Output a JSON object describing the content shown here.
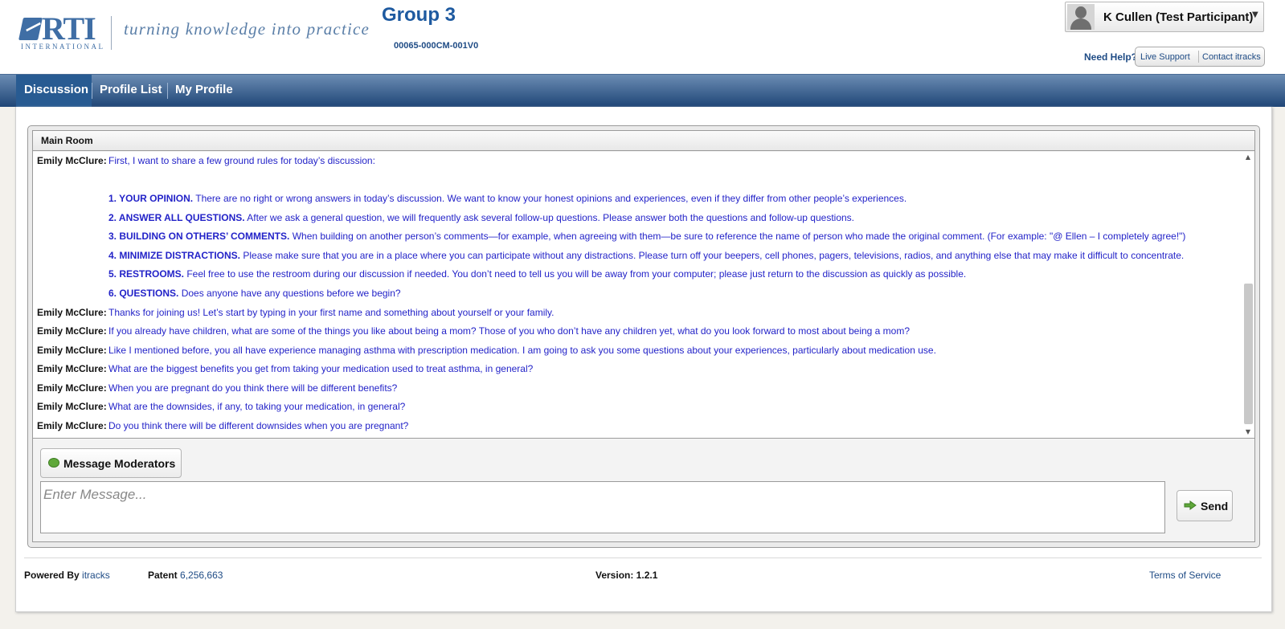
{
  "header": {
    "logo_text": "RTI",
    "logo_sub": "INTERNATIONAL",
    "tagline": "turning knowledge into practice",
    "group_title": "Group 3",
    "group_code": "00065-000CM-001V0",
    "user_name": "K Cullen (Test Participant)",
    "need_help": "Need Help?",
    "live_support": "Live Support",
    "contact": "Contact itracks"
  },
  "nav": {
    "items": [
      {
        "label": "Discussion",
        "active": true
      },
      {
        "label": "Profile List",
        "active": false
      },
      {
        "label": "My Profile",
        "active": false
      }
    ]
  },
  "chat": {
    "room_title": "Main Room",
    "messages": [
      {
        "sender": "Emily McClure:",
        "text": "First, I want to share a few ground rules for today’s discussion:"
      },
      {
        "sender": "",
        "bold": "1. YOUR OPINION.",
        "text": " There are no right or wrong answers in today’s discussion. We want to know your honest opinions and experiences, even if they differ from other people’s experiences."
      },
      {
        "sender": "",
        "bold": "2. ANSWER ALL QUESTIONS.",
        "text": " After we ask a general question, we will frequently ask several follow-up questions. Please answer both the questions and follow-up questions."
      },
      {
        "sender": "",
        "bold": "3. BUILDING ON OTHERS’ COMMENTS.",
        "text": " When building on another person’s comments—for example, when agreeing with them—be sure to reference the name of person who made the original comment. (For example: \"@ Ellen – I completely agree!\")"
      },
      {
        "sender": "",
        "bold": "4. MINIMIZE DISTRACTIONS.",
        "text": " Please make sure that you are in a place where you can participate without any distractions. Please turn off your beepers, cell phones, pagers, televisions, radios, and anything else that may make it difficult to concentrate."
      },
      {
        "sender": "",
        "bold": "5. RESTROOMS.",
        "text": " Feel free to use the restroom during our discussion if needed. You don’t need to tell us you will be away from your computer; please just return to the discussion as quickly as possible."
      },
      {
        "sender": "",
        "bold": "6. QUESTIONS.",
        "text": " Does anyone have any questions before we begin?"
      },
      {
        "sender": "Emily McClure:",
        "text": "Thanks for joining us! Let’s start by typing in your first name and something about yourself or your family."
      },
      {
        "sender": "Emily McClure:",
        "text": "If you already have children, what are some of the things you like about being a mom? Those of you who don’t have any children yet, what do you look forward to most about being a mom?"
      },
      {
        "sender": "Emily McClure:",
        "text": "Like I mentioned before, you all have experience managing asthma with prescription medication. I am going to ask you some questions about your experiences, particularly about medication use."
      },
      {
        "sender": "Emily McClure:",
        "text": "What are the biggest benefits you get from taking your medication used to treat asthma, in general?"
      },
      {
        "sender": "Emily McClure:",
        "text": "When you are pregnant do you think there will be different benefits?"
      },
      {
        "sender": "Emily McClure:",
        "text": "What are the downsides, if any, to taking your medication, in general?"
      },
      {
        "sender": "Emily McClure:",
        "text": "Do you think there will be different downsides when you are pregnant?"
      }
    ],
    "moderator_button": "Message Moderators",
    "input_placeholder": "Enter Message...",
    "send_button": "Send"
  },
  "footer": {
    "powered_label": "Powered By",
    "powered_value": "itracks",
    "patent_label": "Patent",
    "patent_value": "6,256,663",
    "version": "Version: 1.2.1",
    "terms": "Terms of Service"
  },
  "colors": {
    "brand_blue": "#1e5aa0",
    "message_text": "#2323c8",
    "nav_dark": "#1f4677"
  },
  "icons": [
    "user-avatar-icon",
    "dropdown-caret-icon",
    "chat-bubble-icon",
    "send-arrow-icon",
    "scroll-up-icon",
    "scroll-down-icon"
  ]
}
